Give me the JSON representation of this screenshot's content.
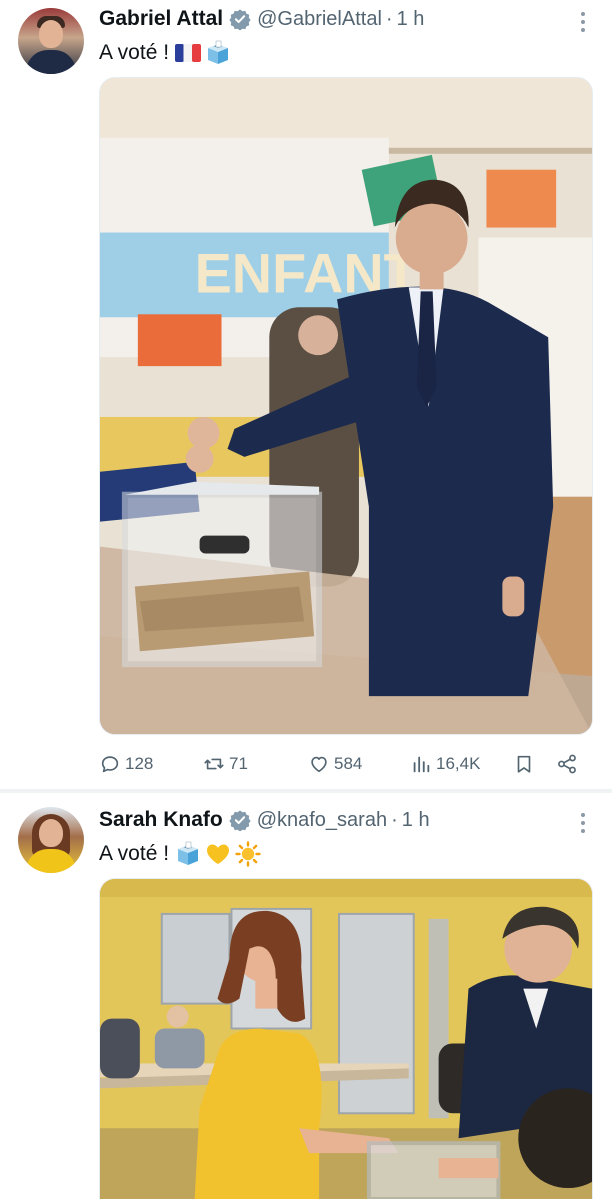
{
  "tweets": [
    {
      "display_name": "Gabriel Attal",
      "handle": "@GabrielAttal",
      "separator": "·",
      "time": "1 h",
      "text": "A voté !",
      "emojis": [
        "flag-france-icon",
        "ballot-box-icon"
      ],
      "media": {
        "sign_text": "ENFANT"
      },
      "stats": {
        "replies": "128",
        "reposts": "71",
        "likes": "584",
        "views": "16,4K"
      }
    },
    {
      "display_name": "Sarah Knafo",
      "handle": "@knafo_sarah",
      "separator": "·",
      "time": "1 h",
      "text": "A voté !",
      "emojis": [
        "ballot-box-icon",
        "yellow-heart-icon",
        "sun-icon"
      ]
    }
  ],
  "colors": {
    "text_primary": "#0f1419",
    "text_secondary": "#536471",
    "separator": "#eff3f4",
    "verified_badge": "#829aab"
  }
}
